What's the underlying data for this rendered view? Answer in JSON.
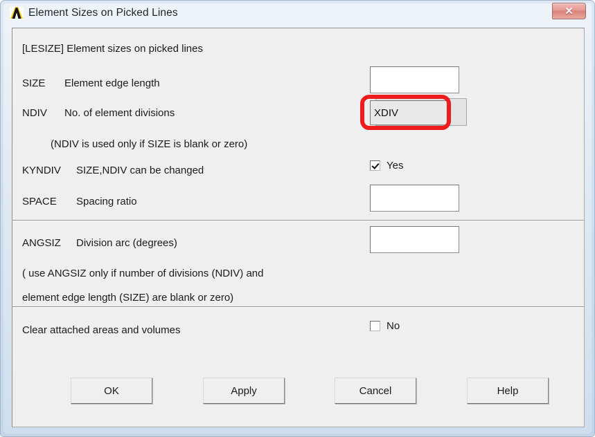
{
  "window": {
    "title": "Element Sizes on Picked Lines",
    "app_icon": "ansys-lambda-icon",
    "close_label": "✕",
    "accent_colors": {
      "frame": "#c4d6e8",
      "client_bg": "#efefef",
      "close_button": "#e59992",
      "annotation_red": "#ee1c1c"
    }
  },
  "form": {
    "heading": "[LESIZE] Element sizes on picked lines",
    "fields": [
      {
        "key": "SIZE",
        "key_label": "SIZE",
        "description": "Element edge length",
        "value": "",
        "placeholder": "",
        "state": "normal"
      },
      {
        "key": "NDIV",
        "key_label": "NDIV",
        "description": "No. of element divisions",
        "value": "XDIV",
        "placeholder": "",
        "state": "highlighted"
      },
      {
        "key": "SPACE",
        "key_label": "SPACE",
        "description": "Spacing ratio",
        "value": "",
        "placeholder": "",
        "state": "normal"
      },
      {
        "key": "ANGSIZ",
        "key_label": "ANGSIZ",
        "description": "Division arc (degrees)",
        "value": "",
        "placeholder": "",
        "state": "normal"
      }
    ],
    "note_ndiv": "(NDIV is used only if SIZE is blank or zero)",
    "kyndiv": {
      "key_label": "KYNDIV",
      "description": "SIZE,NDIV can be changed",
      "checkbox_label": "Yes",
      "checked": true
    },
    "note_angsiz_line1": "( use ANGSIZ only if number of divisions (NDIV) and",
    "note_angsiz_line2": "element edge length (SIZE) are blank or zero)",
    "clear_attached": {
      "description": "Clear attached areas and volumes",
      "checkbox_label": "No",
      "checked": false
    }
  },
  "buttons": {
    "ok": "OK",
    "apply": "Apply",
    "cancel": "Cancel",
    "help": "Help"
  }
}
